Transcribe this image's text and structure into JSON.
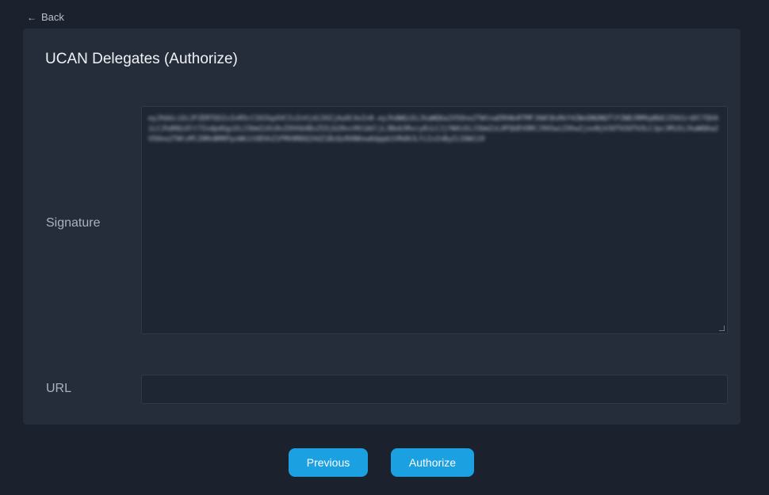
{
  "nav": {
    "back_label": "Back",
    "back_icon": "arrow-left-icon"
  },
  "card": {
    "title": "UCAN Delegates (Authorize)",
    "signature": {
      "label": "Signature",
      "value": "eyJhbGciOiJFZERTQSIsInR5cCI6IkpXVCIsInVjdiI6IjAuOC4xIn0.eyJhdWQiOiJkaWQ6a2V5Ono2TWtnaERhNnRTMFJ6WlBsRkY4ZWxDNUNQTlFZWDJRMVpBbEJZVU1rdXlTQVAiLCJhdHQiOlt7IndpdGgiOiJ3bmZzOi8vZXhhbXBsZS5jb20vcHVibGljL3Bob3Rvcy8iLCJjYW4iOiJ3bmZzL0FQUEVORCJ9XSwiZXhwIjoxNjk5OTk5OTk5LCJpc3MiOiJkaWQ6a2V5Ono2TWtzMlZ0RnBRRFpzWk1tOEhhZ1FMV0RDQ1hUZ1BzQzRXN0xwbUppb1VRd0JLYiIsInByZiI6W119"
    },
    "url": {
      "label": "URL",
      "value": ""
    }
  },
  "buttons": {
    "previous": "Previous",
    "authorize": "Authorize"
  },
  "colors": {
    "page_bg": "#1b212d",
    "card_bg": "#252d3b",
    "field_bg": "#1f2633",
    "accent": "#1ba1e2"
  }
}
